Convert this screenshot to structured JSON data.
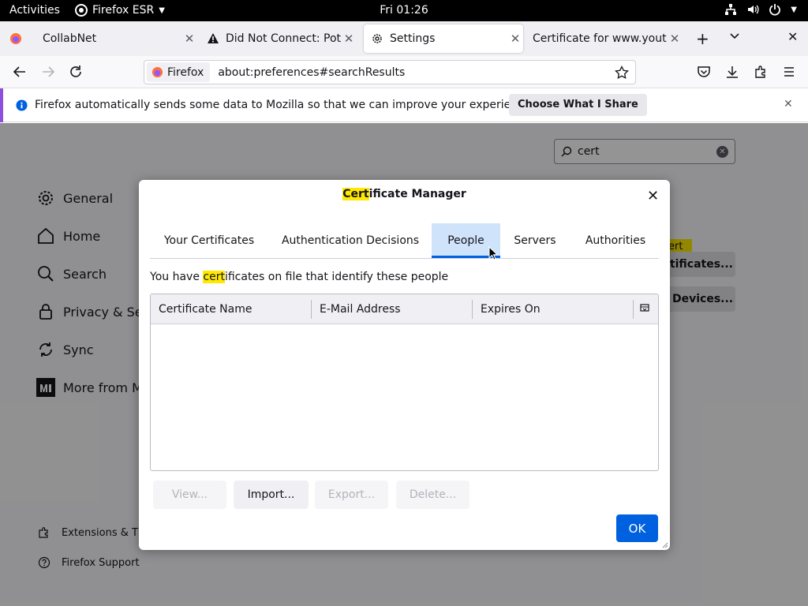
{
  "topbar": {
    "activities": "Activities",
    "app_name": "Firefox ESR",
    "clock": "Fri 01:26"
  },
  "tabs": [
    {
      "title": "CollabNet",
      "icon": "firefox-icon"
    },
    {
      "title": "Did Not Connect: Pote",
      "icon": "warning-icon"
    },
    {
      "title": "Settings",
      "icon": "gear-icon",
      "active": true
    },
    {
      "title": "Certificate for www.youtu",
      "icon": "none"
    }
  ],
  "navbar": {
    "identity_label": "Firefox",
    "url": "about:preferences#searchResults"
  },
  "notification": {
    "message": "Firefox automatically sends some data to Mozilla so that we can improve your experience.",
    "button": "Choose What I Share"
  },
  "settings": {
    "search_value": "cert",
    "categories": [
      "General",
      "Home",
      "Search",
      "Privacy & Secu",
      "Sync",
      "More from Mo"
    ],
    "footer_links": [
      "Extensions & The",
      "Firefox Support"
    ],
    "right_buttons": [
      "rtificates...",
      "Devices..."
    ],
    "highlight_tag": "ert"
  },
  "dialog": {
    "title_mark": "Cert",
    "title_rest": "ificate Manager",
    "tabs": [
      "Your Certificates",
      "Authentication Decisions",
      "People",
      "Servers",
      "Authorities"
    ],
    "active_tab": "People",
    "desc_pre": "You have ",
    "desc_mark": "cert",
    "desc_post": "ificates on file that identify these people",
    "columns": [
      "Certificate Name",
      "E-Mail Address",
      "Expires On"
    ],
    "buttons": {
      "view": "View...",
      "import": "Import...",
      "export": "Export...",
      "delete": "Delete..."
    },
    "ok": "OK"
  },
  "colors": {
    "accent_blue": "#0061e0",
    "highlight": "#ffe900",
    "active_tab_bg": "#cfe3fb"
  }
}
